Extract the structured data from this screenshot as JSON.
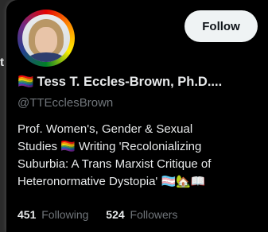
{
  "left_fragment": "t",
  "profile": {
    "name_emoji": "🏳️‍🌈",
    "display_name": "Tess T. Eccles-Brown, Ph.D....",
    "handle": "@TTEcclesBrown",
    "avatar_icon": "user-avatar-photo"
  },
  "actions": {
    "follow_label": "Follow"
  },
  "bio": {
    "line1": "Prof. Women's, Gender & Sexual",
    "line2": "Studies 🏳️‍🌈 Writing 'Recolonializing",
    "line3": "Suburbia: A Trans Marxist Critique of",
    "line4": "Heteronormative Dystopia' 🏳️‍⚧️🏡📖"
  },
  "stats": {
    "following_count": "451",
    "following_label": "Following",
    "followers_count": "524",
    "followers_label": "Followers"
  },
  "colors": {
    "background": "#000000",
    "text_primary": "#e7e9ea",
    "text_secondary": "#71767b",
    "follow_button_bg": "#eff3f4"
  }
}
